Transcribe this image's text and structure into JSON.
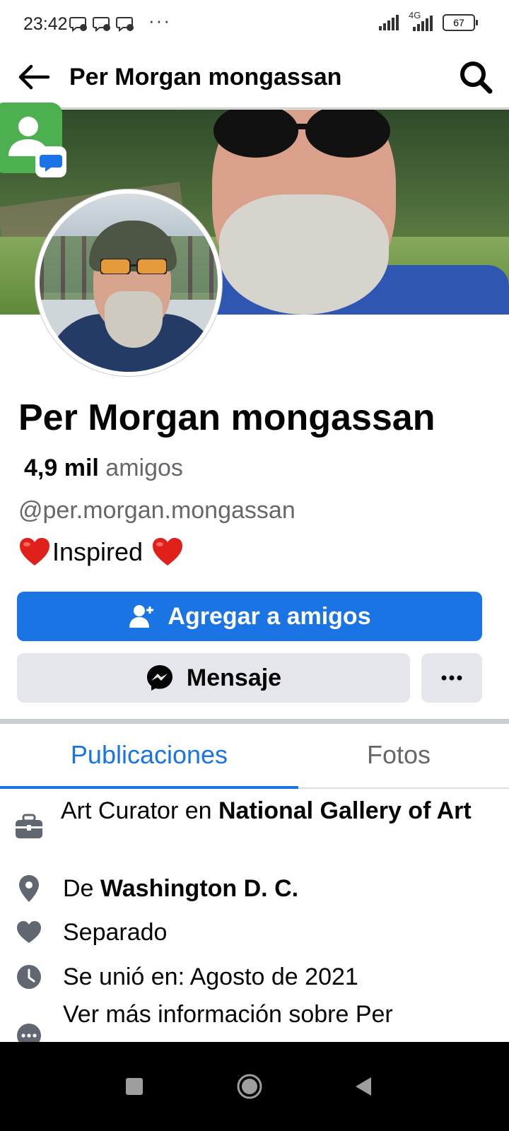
{
  "status_bar": {
    "time": "23:42",
    "dots": "···",
    "network": "4G",
    "battery": "67"
  },
  "app_bar": {
    "title": "Per Morgan mongassan"
  },
  "profile": {
    "name": "Per Morgan mongassan",
    "friends_count": "4,9 mil",
    "friends_label": "amigos",
    "username": "@per.morgan.mongassan",
    "bio_text": "Inspired"
  },
  "actions": {
    "add_friend": "Agregar a amigos",
    "message": "Mensaje",
    "more": "···"
  },
  "tabs": [
    {
      "label": "Publicaciones",
      "active": true
    },
    {
      "label": "Fotos",
      "active": false
    }
  ],
  "info": {
    "work_prefix": "Art Curator en ",
    "work_place": "National Gallery of Art",
    "home_prefix": "De ",
    "home_city": "Washington D. C.",
    "relationship": "Separado",
    "joined": "Se unió en: Agosto de 2021",
    "see_more": "Ver más información sobre Per"
  },
  "colors": {
    "accent": "#1b74e4",
    "secondary_button": "#e4e6eb",
    "muted_text": "#65676b"
  }
}
